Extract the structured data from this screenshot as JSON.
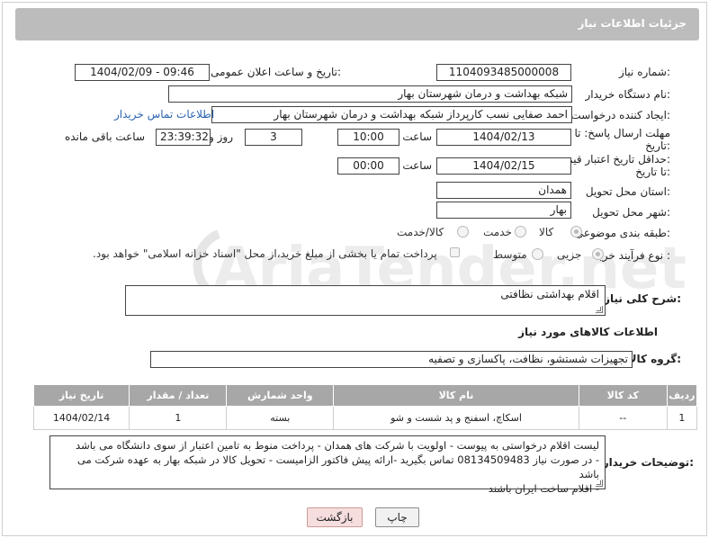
{
  "header": {
    "title": "جزئیات اطلاعات نیاز"
  },
  "fields": {
    "need_number_label": "شماره نیاز:",
    "need_number": "1104093485000008",
    "announce_label": "تاریخ و ساعت اعلان عمومی:",
    "announce_value": "1404/02/09 - 09:46",
    "buyer_org_label": "نام دستگاه خریدار:",
    "buyer_org": "شبکه بهداشت و درمان شهرستان بهار",
    "creator_label": "ایجاد کننده درخواست:",
    "creator": "احمد صفایی نسب کارپرداز شبکه بهداشت و درمان شهرستان بهار",
    "contact_link": "اطلاعات تماس خریدار",
    "deadline_label_1": "مهلت ارسال پاسخ: تا",
    "deadline_label_2": "تاریخ:",
    "deadline_date": "1404/02/13",
    "time_label": "ساعت",
    "deadline_time": "10:00",
    "days_value": "3",
    "days_label": "روز و",
    "remaining_value": "23:39:32",
    "remaining_label": "ساعت باقی مانده",
    "price_label_1": "حداقل تاریخ اعتبار قیمت:",
    "price_label_2": "تا تاریخ:",
    "price_date": "1404/02/15",
    "price_time": "00:00",
    "province_label": "استان محل تحویل:",
    "province": "همدان",
    "city_label": "شهر محل تحویل:",
    "city": "بهار",
    "category_label": "طبقه بندی موضوعی:",
    "category_options": [
      "کالا",
      "خدمت",
      "کالا/خدمت"
    ],
    "process_label": "نوع فرآیند خرید :",
    "process_options": [
      "جزیی",
      "متوسط"
    ],
    "payment_note": "پرداخت تمام یا بخشی از مبلغ خرید،از محل \"اسناد خزانه اسلامی\" خواهد بود."
  },
  "description": {
    "label": "شرح کلی نیاز:",
    "value": "اقلام بهداشتی نظافتی"
  },
  "goods_section": {
    "title": "اطلاعات کالاهای مورد نیاز",
    "group_label": "گروه کالا:",
    "group_value": "تجهیزات شستشو، نظافت، پاکسازی و تصفیه"
  },
  "table": {
    "headers": [
      "ردیف",
      "کد کالا",
      "نام کالا",
      "واحد شمارش",
      "تعداد / مقدار",
      "تاریخ نیاز"
    ],
    "rows": [
      [
        "1",
        "--",
        "اسکاچ، اسفنج و پد شست و شو",
        "بسته",
        "1",
        "1404/02/14"
      ]
    ]
  },
  "buyer_notes": {
    "label": "توضیحات خریدار:",
    "lines": [
      "لیست اقلام درخواستی به پیوست - اولویت با شرکت های همدان - پرداخت منوط به تامین اعتبار از سوی دانشگاه می باشد",
      "- در صورت نیاز 08134509483 تماس بگیرید -ارائه پیش فاکتور الزامیست - تحویل کالا در شبکه بهار به عهده شرکت می باشد",
      "- اقلام ساخت ایران باشند"
    ]
  },
  "buttons": {
    "print": "چاپ",
    "back": "بازگشت"
  },
  "watermark": {
    "text": "AriaTender.net"
  }
}
